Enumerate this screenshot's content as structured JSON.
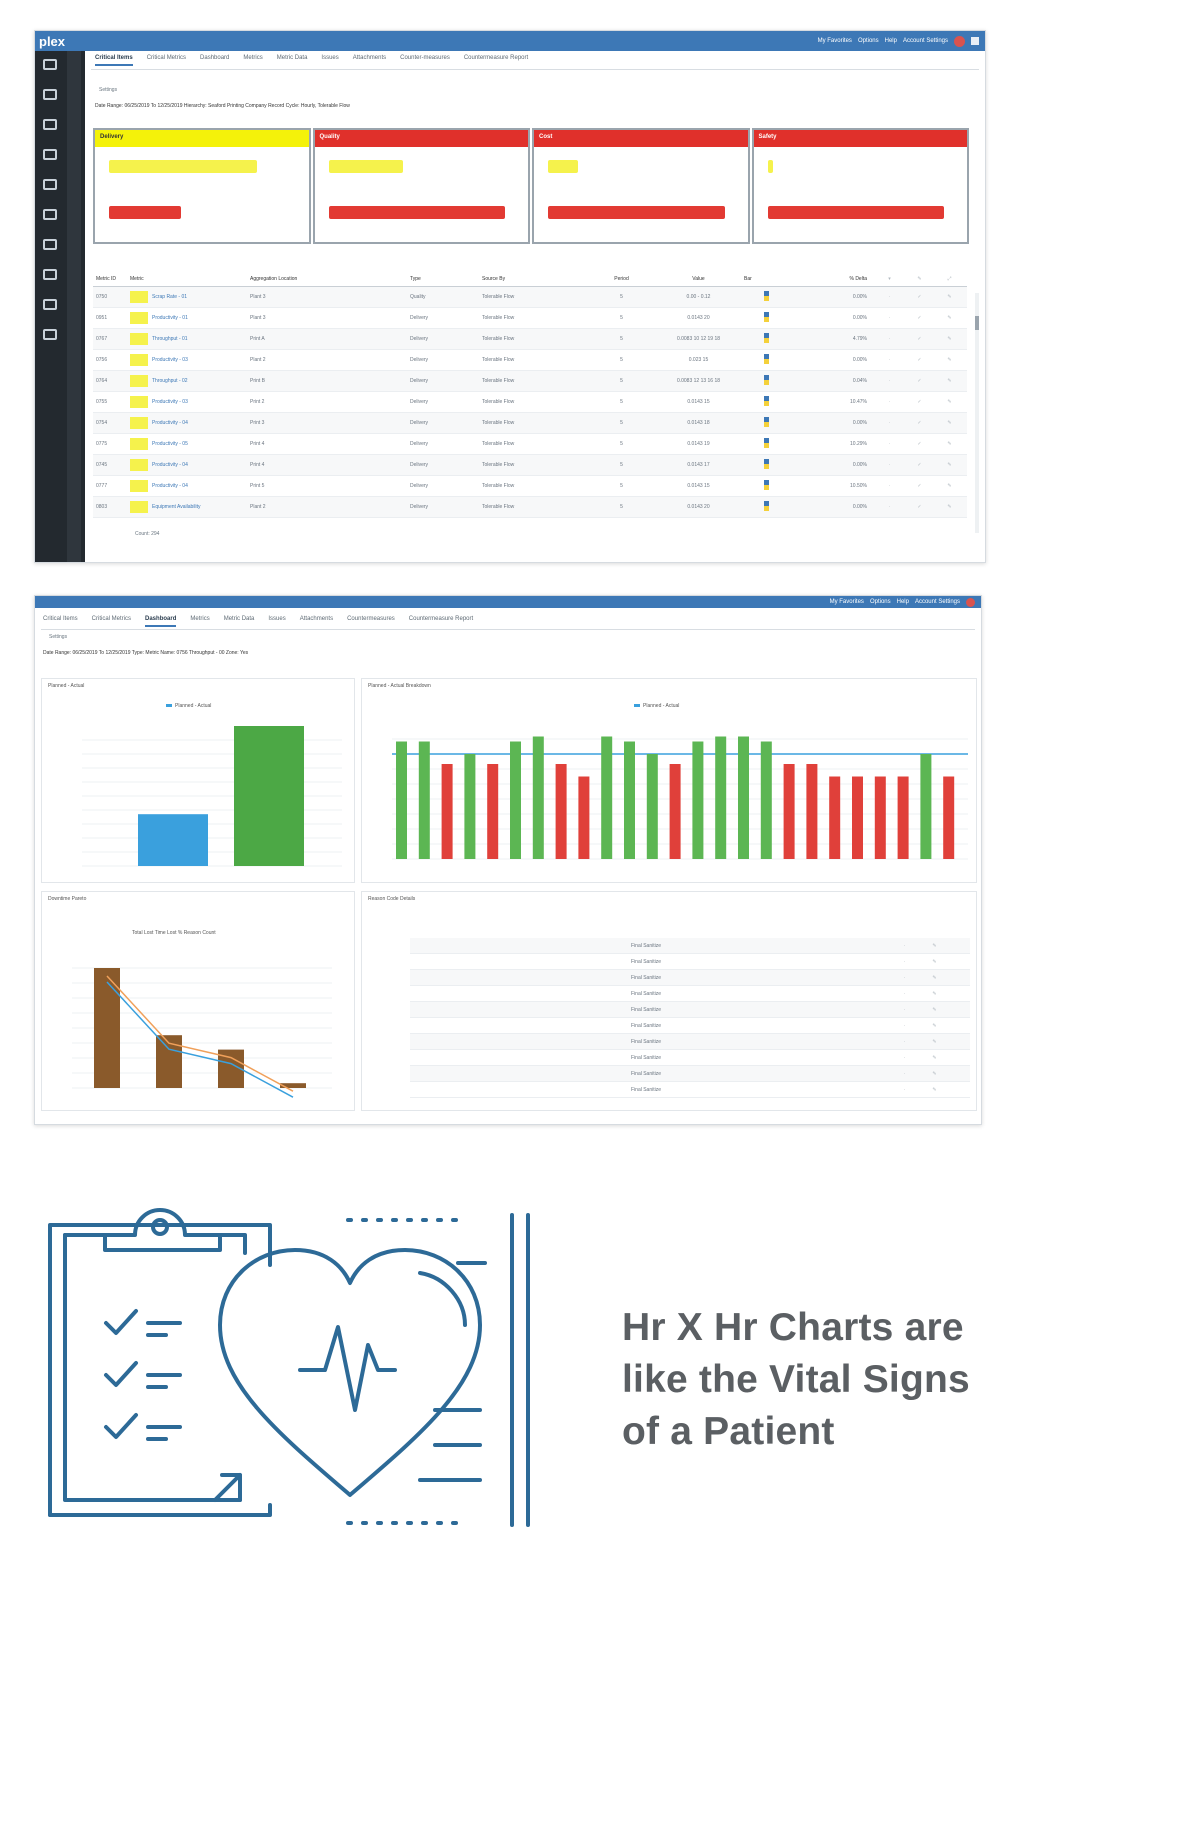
{
  "screen1": {
    "logo": "plex",
    "topbar": [
      "My Favorites",
      "Options",
      "Help",
      "Account Settings"
    ],
    "tabs": [
      "Critical Items",
      "Critical Metrics",
      "Dashboard",
      "Metrics",
      "Metric Data",
      "Issues",
      "Attachments",
      "Counter-measures",
      "Countermeasure Report"
    ],
    "settings": "Settings",
    "filter": "Date Range: 06/25/2019 To 12/25/2019   Hierarchy: Seaford Printing Company   Record Cycle: Hourly, Tolerable Flow",
    "cards": [
      {
        "label": "Delivery",
        "color": "yellow",
        "top_pct": 0.78,
        "bottom_pct": 0.38
      },
      {
        "label": "Quality",
        "color": "red",
        "top_pct": 0.39,
        "bottom_pct": 0.93
      },
      {
        "label": "Cost",
        "color": "red",
        "top_pct": 0.16,
        "bottom_pct": 0.93
      },
      {
        "label": "Safety",
        "color": "red",
        "top_pct": 0.03,
        "bottom_pct": 0.93
      }
    ],
    "table_headers": [
      "Metric ID",
      "Metric",
      "Aggregation Location",
      "Type",
      "Source By",
      "Period",
      "Value",
      "Bar",
      "% Delta"
    ],
    "rows": [
      {
        "id": "0750",
        "metric": "Scrap Rate - 01",
        "loc": "Plant 3",
        "type": "Quality",
        "src": "Tolerable Flow",
        "period": "5",
        "val": "0.00 - 0.12",
        "pct": "0.00%"
      },
      {
        "id": "0951",
        "metric": "Productivity - 01",
        "loc": "Plant 3",
        "type": "Delivery",
        "src": "Tolerable Flow",
        "period": "5",
        "val": "0.0143 20",
        "pct": "0.00%"
      },
      {
        "id": "0767",
        "metric": "Throughput - 01",
        "loc": "Print A",
        "type": "Delivery",
        "src": "Tolerable Flow",
        "period": "5",
        "val": "0.0083 10 12 19 18",
        "pct": "4.79%"
      },
      {
        "id": "0756",
        "metric": "Productivity - 03",
        "loc": "Plant 2",
        "type": "Delivery",
        "src": "Tolerable Flow",
        "period": "5",
        "val": "0.023 15",
        "pct": "0.00%"
      },
      {
        "id": "0764",
        "metric": "Throughput - 02",
        "loc": "Print B",
        "type": "Delivery",
        "src": "Tolerable Flow",
        "period": "5",
        "val": "0.0083 12 13 16 18",
        "pct": "0.04%"
      },
      {
        "id": "0755",
        "metric": "Productivity - 03",
        "loc": "Print 2",
        "type": "Delivery",
        "src": "Tolerable Flow",
        "period": "5",
        "val": "0.0143 15",
        "pct": "10.47%"
      },
      {
        "id": "0754",
        "metric": "Productivity - 04",
        "loc": "Print 3",
        "type": "Delivery",
        "src": "Tolerable Flow",
        "period": "5",
        "val": "0.0143 18",
        "pct": "0.00%"
      },
      {
        "id": "0775",
        "metric": "Productivity - 05",
        "loc": "Print 4",
        "type": "Delivery",
        "src": "Tolerable Flow",
        "period": "5",
        "val": "0.0143 19",
        "pct": "10.29%"
      },
      {
        "id": "0745",
        "metric": "Productivity - 04",
        "loc": "Print 4",
        "type": "Delivery",
        "src": "Tolerable Flow",
        "period": "5",
        "val": "0.0143 17",
        "pct": "0.00%"
      },
      {
        "id": "0777",
        "metric": "Productivity - 04",
        "loc": "Print 5",
        "type": "Delivery",
        "src": "Tolerable Flow",
        "period": "5",
        "val": "0.0143 15",
        "pct": "10.50%"
      },
      {
        "id": "0803",
        "metric": "Equipment Availability",
        "loc": "Plant 2",
        "type": "Delivery",
        "src": "Tolerable Flow",
        "period": "5",
        "val": "0.0143 20",
        "pct": "0.00%"
      }
    ],
    "footer": "Count: 294"
  },
  "screen2": {
    "tabs": [
      "Critical Items",
      "Critical Metrics",
      "Dashboard",
      "Metrics",
      "Metric Data",
      "Issues",
      "Attachments",
      "Countermeasures",
      "Countermeasure Report"
    ],
    "settings": "Settings",
    "filter": "Date Range: 06/25/2019 To 12/25/2019   Type: Metric   Name: 0756 Throughput - 00   Zone: Yes",
    "panel1_title": "Planned - Actual",
    "panel2_title": "Planned - Actual Breakdown",
    "panel3_title": "Downtime Pareto",
    "panel4_title": "Reason Code Details",
    "legend_pa": "Planned - Actual",
    "legend_pareto": "Total Lost   Time Lost % Reason Count",
    "left_bars": [
      {
        "value": 0.37,
        "color": "#3aa0dd"
      },
      {
        "value": 1.0,
        "color": "#4ca845"
      }
    ],
    "breakdown_bars": [
      0.94,
      0.94,
      0.76,
      0.84,
      0.76,
      0.94,
      0.98,
      0.76,
      0.66,
      0.98,
      0.94,
      0.84,
      0.76,
      0.94,
      0.98,
      0.98,
      0.94,
      0.76,
      0.76,
      0.66,
      0.66,
      0.66,
      0.66,
      0.84,
      0.66
    ],
    "breakdown_colors": [
      "g",
      "g",
      "r",
      "g",
      "r",
      "g",
      "g",
      "r",
      "r",
      "g",
      "g",
      "g",
      "r",
      "g",
      "g",
      "g",
      "g",
      "r",
      "r",
      "r",
      "r",
      "r",
      "r",
      "g",
      "r"
    ],
    "pareto_bars": [
      1.0,
      0.44,
      0.32,
      0.04
    ],
    "reason_rows": 10,
    "reason_status": "Final Sanitize"
  },
  "tagline": [
    "Hr X Hr Charts are",
    "like the Vital Signs",
    "of  a Patient"
  ]
}
